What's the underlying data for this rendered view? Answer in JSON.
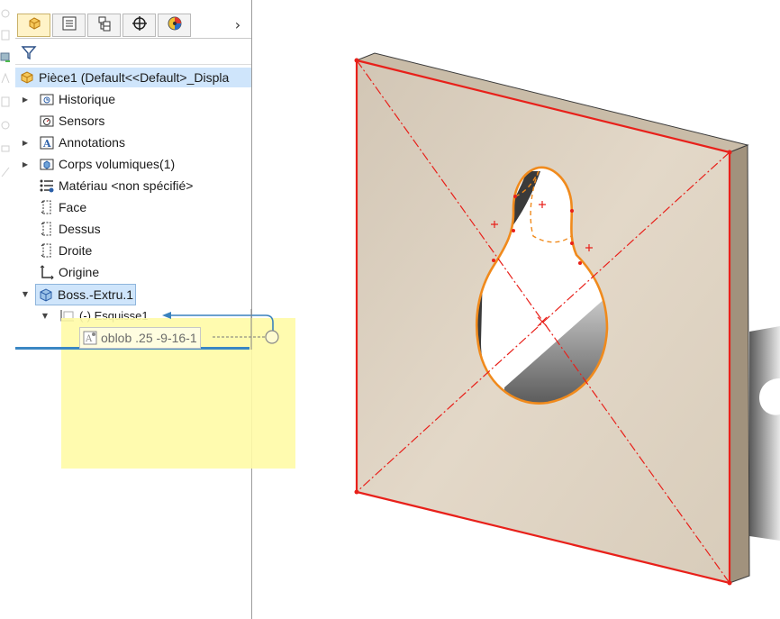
{
  "panel": {
    "tabs": [
      {
        "name": "feature-manager",
        "icon": "part-icon"
      },
      {
        "name": "property-manager",
        "icon": "property-list-icon"
      },
      {
        "name": "configuration-manager",
        "icon": "configuration-icon"
      },
      {
        "name": "dimxpert-manager",
        "icon": "crosshair-icon"
      },
      {
        "name": "display-manager",
        "icon": "appearance-icon"
      }
    ],
    "more": "›",
    "root": "Pièce1  (Default<<Default>_Displa",
    "tree": [
      {
        "label": "Historique",
        "icon": "history-icon",
        "expandable": true
      },
      {
        "label": "Sensors",
        "icon": "sensor-icon",
        "expandable": false
      },
      {
        "label": "Annotations",
        "icon": "annotations-icon",
        "expandable": true
      },
      {
        "label": "Corps volumiques(1)",
        "icon": "solid-bodies-icon",
        "expandable": true
      },
      {
        "label": "Matériau <non spécifié>",
        "icon": "material-icon",
        "expandable": false
      },
      {
        "label": "Face",
        "icon": "plane-icon",
        "expandable": false
      },
      {
        "label": "Dessus",
        "icon": "plane-icon",
        "expandable": false
      },
      {
        "label": "Droite",
        "icon": "plane-icon",
        "expandable": false
      },
      {
        "label": "Origine",
        "icon": "origin-icon",
        "expandable": false
      },
      {
        "label": "Boss.-Extru.1",
        "icon": "extrude-icon",
        "expandable": true,
        "expanded": true
      },
      {
        "label": "(-) Esquisse1",
        "icon": "sketch-icon",
        "expandable": true,
        "expanded": true
      }
    ],
    "drag_label": "oblob .25 -9-16-1"
  },
  "colors": {
    "selection": "#cfe5fb",
    "note": "#fffba6",
    "part_face": "#dccfbd",
    "edge_red": "#e8201a",
    "sketch_orange": "#f08a1c"
  }
}
